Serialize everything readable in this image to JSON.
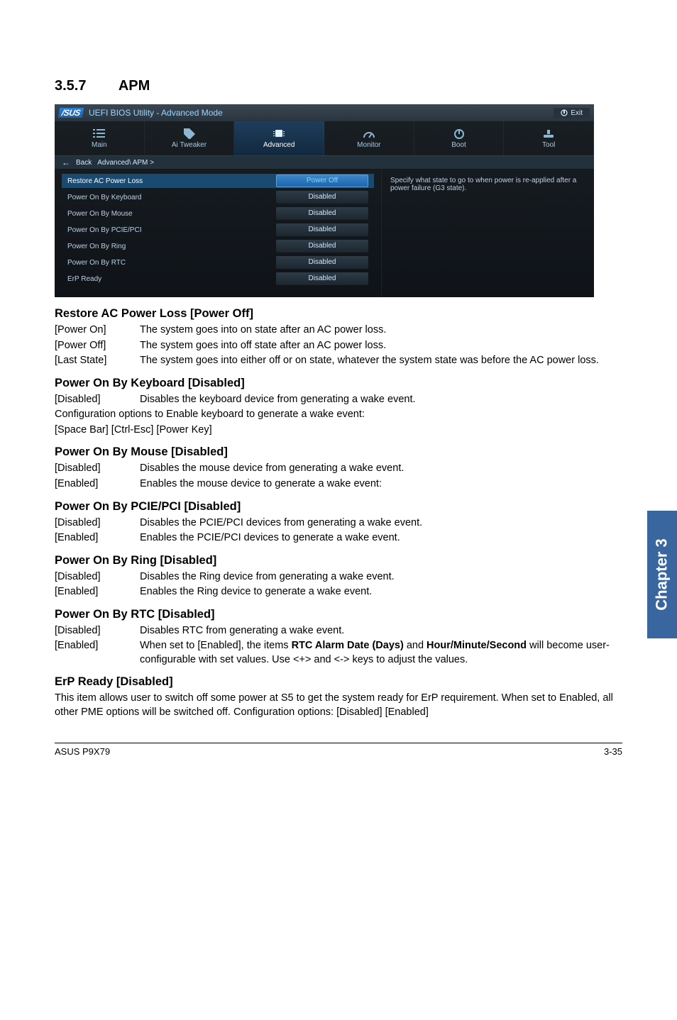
{
  "section": {
    "number": "3.5.7",
    "title": "APM"
  },
  "bios": {
    "brand": "/SUS",
    "title": "UEFI BIOS Utility - Advanced Mode",
    "exit": "Exit",
    "tabs": {
      "main": "Main",
      "ai_tweaker": "Ai Tweaker",
      "advanced": "Advanced",
      "monitor": "Monitor",
      "boot": "Boot",
      "tool": "Tool"
    },
    "breadcrumb": {
      "back": "Back",
      "path": "Advanced\\ APM >"
    },
    "settings": [
      {
        "label": "Restore AC Power Loss",
        "value": "Power Off",
        "selected": true
      },
      {
        "label": "Power On By Keyboard",
        "value": "Disabled"
      },
      {
        "label": "Power On By Mouse",
        "value": "Disabled"
      },
      {
        "label": "Power On By PCIE/PCI",
        "value": "Disabled"
      },
      {
        "label": "Power On By Ring",
        "value": "Disabled"
      },
      {
        "label": "Power On By RTC",
        "value": "Disabled"
      },
      {
        "label": "ErP Ready",
        "value": "Disabled"
      }
    ],
    "help": "Specify what state to go to when power is re-applied after a power failure (G3 state)."
  },
  "doc": {
    "restore": {
      "heading": "Restore AC Power Loss [Power Off]",
      "rows": [
        {
          "key": "[Power On]",
          "val": "The system goes into on state after an AC power loss."
        },
        {
          "key": "[Power Off]",
          "val": "The system goes into off state after an AC power loss."
        },
        {
          "key": "[Last State]",
          "val": "The system goes into either off or on state, whatever the system state was before the AC power loss."
        }
      ]
    },
    "keyboard": {
      "heading": "Power On By Keyboard [Disabled]",
      "rows": [
        {
          "key": "[Disabled]",
          "val": "Disables the keyboard device from generating a wake event."
        }
      ],
      "p1": "Configuration options to Enable keyboard to generate a wake event:",
      "p2": "[Space Bar] [Ctrl-Esc] [Power Key]"
    },
    "mouse": {
      "heading": "Power On By Mouse [Disabled]",
      "rows": [
        {
          "key": "[Disabled]",
          "val": "Disables the mouse device from generating a wake event."
        },
        {
          "key": "[Enabled]",
          "val": "Enables the mouse device to generate a wake event:"
        }
      ]
    },
    "pcie": {
      "heading": "Power On By PCIE/PCI [Disabled]",
      "rows": [
        {
          "key": "[Disabled]",
          "val": "Disables the PCIE/PCI devices from generating a wake event."
        },
        {
          "key": "[Enabled]",
          "val": "Enables the PCIE/PCI devices to generate a wake event."
        }
      ]
    },
    "ring": {
      "heading": "Power On By Ring [Disabled]",
      "rows": [
        {
          "key": "[Disabled]",
          "val": "Disables the Ring device from generating a wake event."
        },
        {
          "key": "[Enabled]",
          "val": "Enables the Ring device to generate a wake event."
        }
      ]
    },
    "rtc": {
      "heading": "Power On By RTC [Disabled]",
      "rows": [
        {
          "key": "[Disabled]",
          "val": "Disables RTC from generating a wake event."
        }
      ],
      "enabled_key": "[Enabled]",
      "enabled_pre": "When set to [Enabled], the items ",
      "enabled_b1": "RTC Alarm Date (Days)",
      "enabled_mid": " and ",
      "enabled_b2": "Hour/Minute/Second",
      "enabled_post": " will become user-configurable with set values. Use <+> and <-> keys to adjust the values."
    },
    "erp": {
      "heading": "ErP Ready [Disabled]",
      "p": "This item allows user to switch off some power at S5 to get the system ready for ErP requirement. When set to Enabled, all other PME options will be switched off. Configuration options: [Disabled] [Enabled]"
    }
  },
  "side_tab": "Chapter 3",
  "footer": {
    "left": "ASUS P9X79",
    "right": "3-35"
  }
}
